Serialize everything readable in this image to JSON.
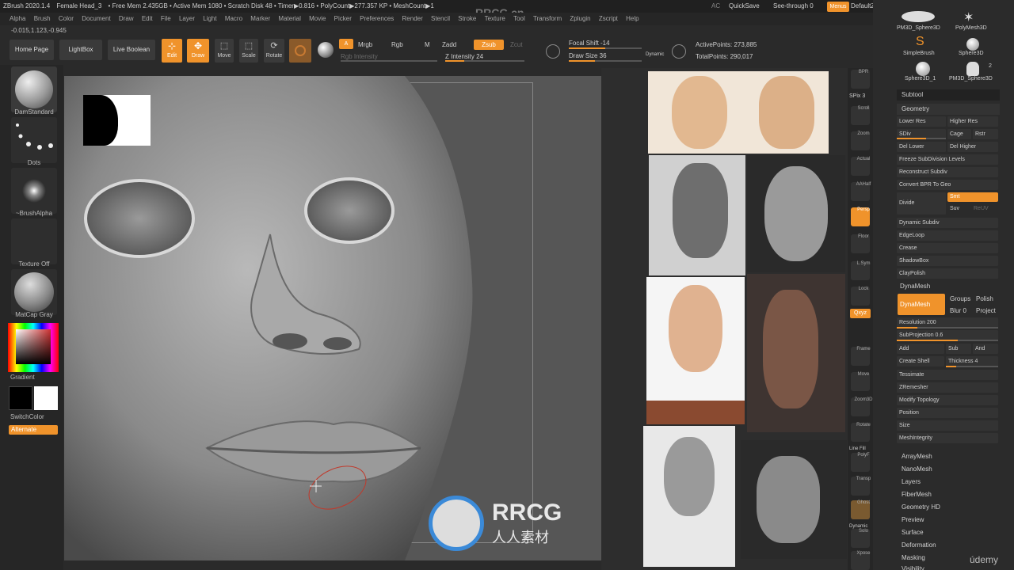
{
  "titlebar": [
    "ZBrush 2020.1.4",
    "Female Head_3",
    "• Free Mem 2.435GB • Active Mem 1080 • Scratch Disk 48 • Timer▶0.816 • PolyCount▶277.357 KP • MeshCount▶1"
  ],
  "menus": [
    "Alpha",
    "Brush",
    "Color",
    "Document",
    "Draw",
    "Edit",
    "File",
    "Layer",
    "Light",
    "Macro",
    "Marker",
    "Material",
    "Movie",
    "Picker",
    "Preferences",
    "Render",
    "Stencil",
    "Stroke",
    "Texture",
    "Tool",
    "Transform",
    "Zplugin",
    "Zscript",
    "Help"
  ],
  "topright": {
    "ac": "AC",
    "quicksave": "QuickSave",
    "seethrough": "See-through  0",
    "menus": "Menus",
    "defaultzscript": "DefaultZScript"
  },
  "coords": "-0.015,1.123,-0.945",
  "toolbar": {
    "homepage": "Home Page",
    "lightbox": "LightBox",
    "liveboolean": "Live Boolean",
    "edit": "Edit",
    "draw": "Draw",
    "move": "Move",
    "scale": "Scale",
    "rotate": "Rotate",
    "a": "A",
    "mrgb": "Mrgb",
    "rgb": "Rgb",
    "m": "M",
    "zadd": "Zadd",
    "zsub": "Zsub",
    "zcut": "Zcut",
    "rgb_intensity": "Rgb Intensity",
    "z_intensity": "Z Intensity 24",
    "focal_shift": "Focal Shift -14",
    "draw_size": "Draw Size 36",
    "dynamic": "Dynamic",
    "active_points": "ActivePoints: 273,885",
    "total_points": "TotalPoints: 290,017"
  },
  "toolbar_levels": {
    "z_intensity": 0.24,
    "draw_size": 0.36
  },
  "leftshelf": {
    "brush": "DamStandard",
    "stroke": "Dots",
    "alpha": "~BrushAlpha",
    "texture": "Texture Off",
    "material": "MatCap Gray",
    "gradient": "Gradient",
    "switchcolor": "SwitchColor",
    "alternate": "Alternate"
  },
  "rightshelf": [
    "BPR",
    "SPix 3",
    "Scroll",
    "Zoom",
    "Actual",
    "AAHalf",
    "Persp",
    "Floor",
    "L.Sym",
    "Lock",
    "Qxyz",
    "",
    "",
    "Frame",
    "Move",
    "Zoom3D",
    "Rotate",
    "Line Fill",
    "PolyF",
    "Transp",
    "Ghost",
    "Dynamic",
    "Solo",
    "Xpose"
  ],
  "tools": [
    "PM3D_Sphere3D",
    "PolyMesh3D",
    "SimpleBrush",
    "Sphere3D",
    "Sphere3D_1",
    "PM3D_Sphere3D"
  ],
  "tool_count": "2",
  "subtool": "Subtool",
  "geometry": {
    "title": "Geometry",
    "lower_res": "Lower Res",
    "higher_res": "Higher Res",
    "sdiv": "SDiv",
    "cage": "Cage",
    "rstr": "Rstr",
    "del_lower": "Del Lower",
    "del_higher": "Del Higher",
    "freeze": "Freeze SubDivision Levels",
    "reconstruct": "Reconstruct Subdiv",
    "convert": "Convert BPR To Geo",
    "divide": "Divide",
    "smt": "Smt",
    "suv": "Suv",
    "reuv": "ReUV",
    "items": [
      "Dynamic Subdiv",
      "EdgeLoop",
      "Crease",
      "ShadowBox",
      "ClayPolish"
    ],
    "dynamesh_header": "DynaMesh",
    "dynamesh": "DynaMesh",
    "groups": "Groups",
    "polish": "Polish",
    "blur": "Blur 0",
    "project": "Project",
    "resolution": "Resolution 200",
    "subprojection": "SubProjection 0.6",
    "add": "Add",
    "sub": "Sub",
    "and": "And",
    "create_shell": "Create Shell",
    "thickness": "Thickness 4",
    "items2": [
      "Tessimate",
      "ZRemesher",
      "Modify Topology",
      "Position",
      "Size",
      "MeshIntegrity"
    ]
  },
  "tray_levels": {
    "sdiv": 0.6,
    "resolution": 0.2,
    "subprojection": 0.6,
    "thickness": 0.2
  },
  "subpalettes": [
    "ArrayMesh",
    "NanoMesh",
    "Layers",
    "FiberMesh",
    "Geometry HD",
    "Preview",
    "Surface",
    "Deformation",
    "Masking",
    "Visibility"
  ],
  "watermark": {
    "top": "RRCG.cn",
    "logo_big": "RRCG",
    "logo_small": "人人素材",
    "udemy": "údemy"
  },
  "colors": {
    "accent": "#f0932b",
    "bg": "#2a2a2a",
    "canvas": "#565656"
  }
}
